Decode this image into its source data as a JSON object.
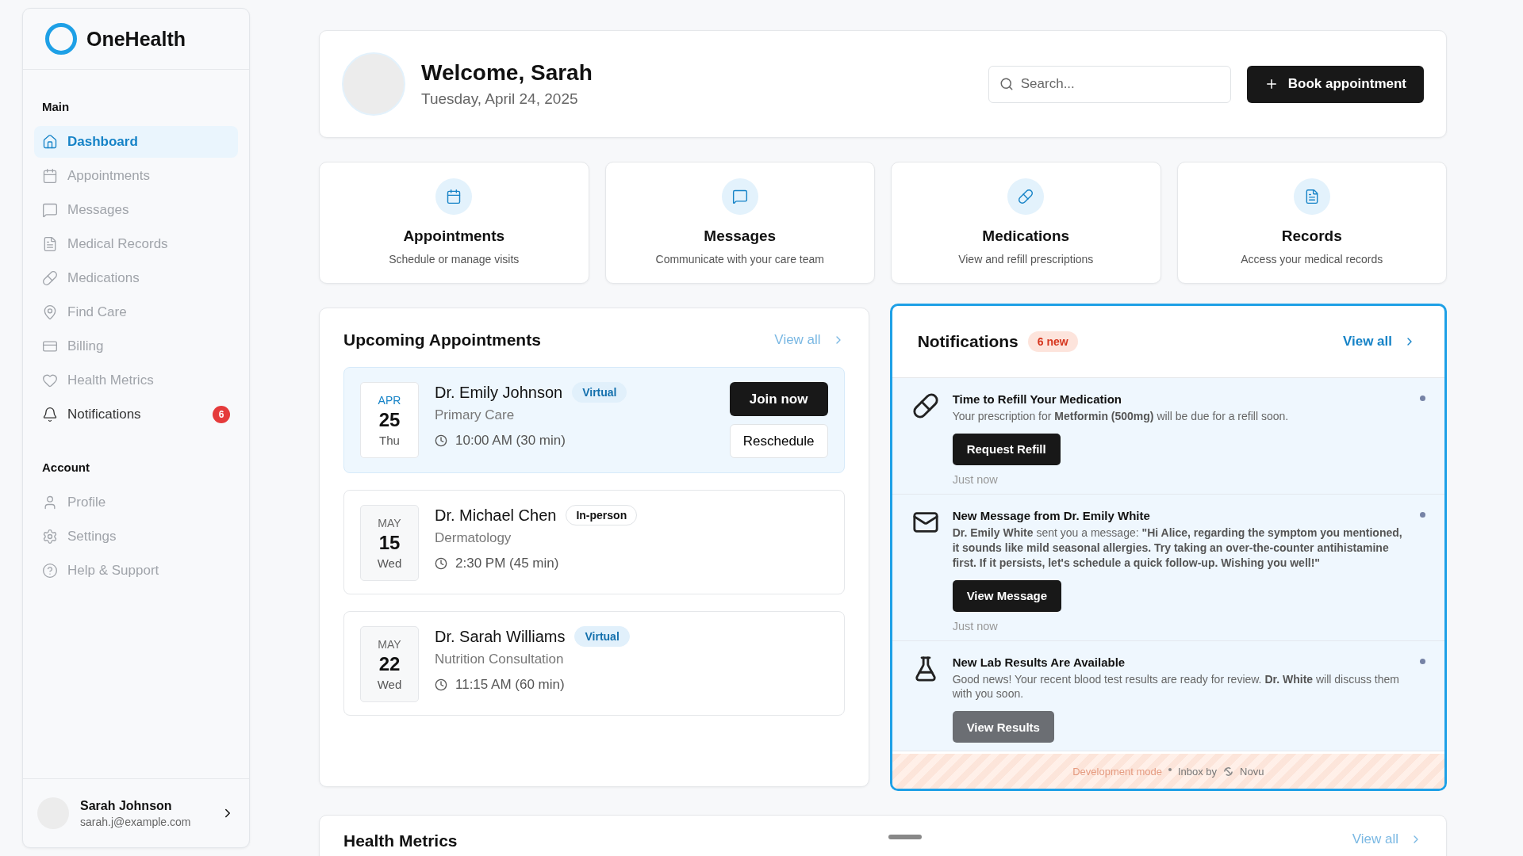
{
  "brand": {
    "name": "OneHealth"
  },
  "sidebar": {
    "sections": [
      {
        "label": "Main",
        "items": [
          {
            "label": "Dashboard",
            "selected": true
          },
          {
            "label": "Appointments",
            "selected": false
          },
          {
            "label": "Messages",
            "selected": false
          },
          {
            "label": "Medical Records",
            "selected": false
          },
          {
            "label": "Medications",
            "selected": false
          },
          {
            "label": "Find Care",
            "selected": false
          },
          {
            "label": "Billing",
            "selected": false
          },
          {
            "label": "Health Metrics",
            "selected": false
          },
          {
            "label": "Notifications",
            "selected": false,
            "badge": "6"
          }
        ]
      },
      {
        "label": "Account",
        "items": [
          {
            "label": "Profile",
            "selected": false
          },
          {
            "label": "Settings",
            "selected": false
          },
          {
            "label": "Help & Support",
            "selected": false
          }
        ]
      }
    ],
    "user": {
      "name": "Sarah Johnson",
      "email": "sarah.j@example.com"
    }
  },
  "header": {
    "title": "Welcome, Sarah",
    "date": "Tuesday, April 24, 2025",
    "search": {
      "placeholder": "Search..."
    },
    "button": "Book appointment"
  },
  "quick_actions": [
    {
      "title": "Appointments",
      "subtitle": "Schedule or manage visits"
    },
    {
      "title": "Messages",
      "subtitle": "Communicate with your care team"
    },
    {
      "title": "Medications",
      "subtitle": "View and refill prescriptions"
    },
    {
      "title": "Records",
      "subtitle": "Access your medical records"
    }
  ],
  "appointments": {
    "title": "Upcoming Appointments",
    "link": "View all",
    "items": [
      {
        "month": "APR",
        "day": "25",
        "weekday": "Thu",
        "doctor": "Dr. Emily Johnson",
        "tag": "Virtual",
        "kind": "virtual",
        "specialty": "Primary Care",
        "time": "10:00 AM (30 min)",
        "highlighted": true,
        "actions": [
          "Join now",
          "Reschedule"
        ]
      },
      {
        "month": "MAY",
        "day": "15",
        "weekday": "Wed",
        "doctor": "Dr. Michael Chen",
        "tag": "In-person",
        "kind": "in-person",
        "specialty": "Dermatology",
        "time": "2:30 PM (45 min)",
        "highlighted": false
      },
      {
        "month": "MAY",
        "day": "22",
        "weekday": "Wed",
        "doctor": "Dr. Sarah Williams",
        "tag": "Virtual",
        "kind": "virtual",
        "specialty": "Nutrition Consultation",
        "time": "11:15 AM (60 min)",
        "highlighted": false
      }
    ]
  },
  "notifications": {
    "title": "Notifications",
    "badge": "6 new",
    "link": "View all",
    "items": [
      {
        "title": "Time to Refill Your Medication",
        "body": "Your prescription for **Metformin (500mg)** will be due for a refill soon.",
        "action": "Request Refill",
        "time": "Just now",
        "unread": true
      },
      {
        "title": "New Message from Dr. Emily White",
        "body": "**Dr. Emily White** sent you a message: **\"Hi Alice, regarding the symptom you mentioned, it sounds like mild seasonal allergies. Try taking an over-the-counter antihistamine first. If it persists, let's schedule a quick follow-up. Wishing you well!\"**",
        "action": "View Message",
        "time": "Just now",
        "unread": true
      },
      {
        "title": "New Lab Results Are Available",
        "body": "Good news! Your recent blood test results are ready for review. **Dr. White** will discuss them with you soon.",
        "action": "View Results",
        "unread": true
      }
    ],
    "footer": {
      "mode": "Development mode",
      "inbox": "Inbox by",
      "vendor": "Novu"
    }
  },
  "health_metrics": {
    "title": "Health Metrics",
    "link": "View all"
  }
}
